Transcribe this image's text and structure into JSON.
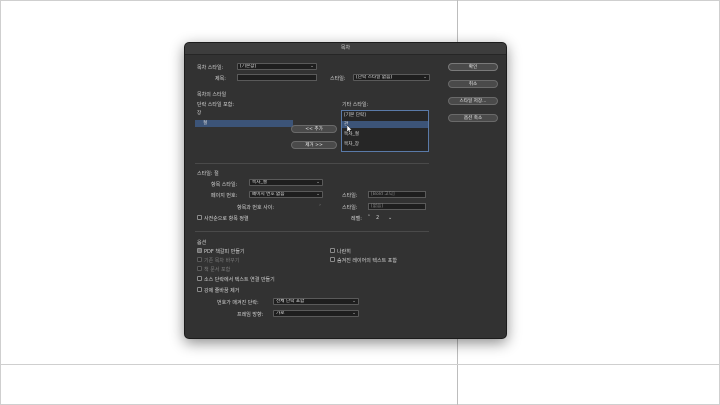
{
  "dialog": {
    "title": "목차",
    "toc_style_label": "목차 스타일:",
    "toc_style_value": "[기본값]",
    "title_label": "제목:",
    "title_value": "",
    "style_label": "스타일:",
    "style_value": "[단락 스타일 없음]",
    "section_toc_styles": "목차의 스타일",
    "include_para_styles_label": "단락 스타일 포함:",
    "included_items": [
      "장",
      "절"
    ],
    "other_styles_label": "기타 스타일:",
    "other_styles_items": [
      "[기본 단락]",
      "관",
      "목차_절",
      "목차_장"
    ],
    "add_button": "<< 추가",
    "remove_button": "제거 >>",
    "style_section": "스타일: 절",
    "entry_style_label": "항목 스타일:",
    "entry_style_value": "목차_절",
    "page_number_label": "페이지 번호:",
    "page_number_value": "페이지 번호 없음",
    "page_style_label": "스타일:",
    "page_style_value": "[Bold 고딕]",
    "between_label": "항목과 번호 사이:",
    "between_style_label": "스타일:",
    "between_style_value": "[없음]",
    "sort_label": "사전순으로 항목 정렬",
    "level_label": "레벨:",
    "level_value": "2",
    "options_section": "옵션",
    "opt_pdf": "PDF 책갈피 만들기",
    "opt_replace": "기존 목차 바꾸기",
    "opt_book": "책 문서 포함",
    "opt_link": "소스 단락에서 텍스트 연결 만들기",
    "opt_remove_breaks": "강제 줄바꿈 제거",
    "opt_run_in": "나란히",
    "opt_hidden_layers": "숨겨진 레이어의 텍스트 포함",
    "numbered_label": "번호가 매겨진 단락:",
    "numbered_value": "전체 단락 포함",
    "frame_dir_label": "프레임 방향:",
    "frame_dir_value": "가로",
    "ok_button": "확인",
    "cancel_button": "취소",
    "save_style_button": "스타일 저장...",
    "fewer_options_button": "옵션 축소"
  }
}
